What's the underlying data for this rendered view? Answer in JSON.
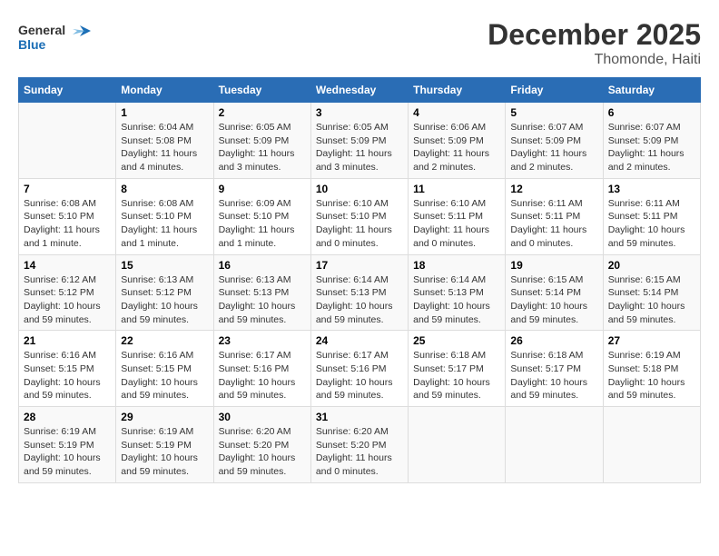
{
  "header": {
    "logo_line1": "General",
    "logo_line2": "Blue",
    "title": "December 2025",
    "subtitle": "Thomonde, Haiti"
  },
  "weekdays": [
    "Sunday",
    "Monday",
    "Tuesday",
    "Wednesday",
    "Thursday",
    "Friday",
    "Saturday"
  ],
  "weeks": [
    [
      {
        "day": "",
        "info": ""
      },
      {
        "day": "1",
        "info": "Sunrise: 6:04 AM\nSunset: 5:08 PM\nDaylight: 11 hours\nand 4 minutes."
      },
      {
        "day": "2",
        "info": "Sunrise: 6:05 AM\nSunset: 5:09 PM\nDaylight: 11 hours\nand 3 minutes."
      },
      {
        "day": "3",
        "info": "Sunrise: 6:05 AM\nSunset: 5:09 PM\nDaylight: 11 hours\nand 3 minutes."
      },
      {
        "day": "4",
        "info": "Sunrise: 6:06 AM\nSunset: 5:09 PM\nDaylight: 11 hours\nand 2 minutes."
      },
      {
        "day": "5",
        "info": "Sunrise: 6:07 AM\nSunset: 5:09 PM\nDaylight: 11 hours\nand 2 minutes."
      },
      {
        "day": "6",
        "info": "Sunrise: 6:07 AM\nSunset: 5:09 PM\nDaylight: 11 hours\nand 2 minutes."
      }
    ],
    [
      {
        "day": "7",
        "info": "Sunrise: 6:08 AM\nSunset: 5:10 PM\nDaylight: 11 hours\nand 1 minute."
      },
      {
        "day": "8",
        "info": "Sunrise: 6:08 AM\nSunset: 5:10 PM\nDaylight: 11 hours\nand 1 minute."
      },
      {
        "day": "9",
        "info": "Sunrise: 6:09 AM\nSunset: 5:10 PM\nDaylight: 11 hours\nand 1 minute."
      },
      {
        "day": "10",
        "info": "Sunrise: 6:10 AM\nSunset: 5:10 PM\nDaylight: 11 hours\nand 0 minutes."
      },
      {
        "day": "11",
        "info": "Sunrise: 6:10 AM\nSunset: 5:11 PM\nDaylight: 11 hours\nand 0 minutes."
      },
      {
        "day": "12",
        "info": "Sunrise: 6:11 AM\nSunset: 5:11 PM\nDaylight: 11 hours\nand 0 minutes."
      },
      {
        "day": "13",
        "info": "Sunrise: 6:11 AM\nSunset: 5:11 PM\nDaylight: 10 hours\nand 59 minutes."
      }
    ],
    [
      {
        "day": "14",
        "info": "Sunrise: 6:12 AM\nSunset: 5:12 PM\nDaylight: 10 hours\nand 59 minutes."
      },
      {
        "day": "15",
        "info": "Sunrise: 6:13 AM\nSunset: 5:12 PM\nDaylight: 10 hours\nand 59 minutes."
      },
      {
        "day": "16",
        "info": "Sunrise: 6:13 AM\nSunset: 5:13 PM\nDaylight: 10 hours\nand 59 minutes."
      },
      {
        "day": "17",
        "info": "Sunrise: 6:14 AM\nSunset: 5:13 PM\nDaylight: 10 hours\nand 59 minutes."
      },
      {
        "day": "18",
        "info": "Sunrise: 6:14 AM\nSunset: 5:13 PM\nDaylight: 10 hours\nand 59 minutes."
      },
      {
        "day": "19",
        "info": "Sunrise: 6:15 AM\nSunset: 5:14 PM\nDaylight: 10 hours\nand 59 minutes."
      },
      {
        "day": "20",
        "info": "Sunrise: 6:15 AM\nSunset: 5:14 PM\nDaylight: 10 hours\nand 59 minutes."
      }
    ],
    [
      {
        "day": "21",
        "info": "Sunrise: 6:16 AM\nSunset: 5:15 PM\nDaylight: 10 hours\nand 59 minutes."
      },
      {
        "day": "22",
        "info": "Sunrise: 6:16 AM\nSunset: 5:15 PM\nDaylight: 10 hours\nand 59 minutes."
      },
      {
        "day": "23",
        "info": "Sunrise: 6:17 AM\nSunset: 5:16 PM\nDaylight: 10 hours\nand 59 minutes."
      },
      {
        "day": "24",
        "info": "Sunrise: 6:17 AM\nSunset: 5:16 PM\nDaylight: 10 hours\nand 59 minutes."
      },
      {
        "day": "25",
        "info": "Sunrise: 6:18 AM\nSunset: 5:17 PM\nDaylight: 10 hours\nand 59 minutes."
      },
      {
        "day": "26",
        "info": "Sunrise: 6:18 AM\nSunset: 5:17 PM\nDaylight: 10 hours\nand 59 minutes."
      },
      {
        "day": "27",
        "info": "Sunrise: 6:19 AM\nSunset: 5:18 PM\nDaylight: 10 hours\nand 59 minutes."
      }
    ],
    [
      {
        "day": "28",
        "info": "Sunrise: 6:19 AM\nSunset: 5:19 PM\nDaylight: 10 hours\nand 59 minutes."
      },
      {
        "day": "29",
        "info": "Sunrise: 6:19 AM\nSunset: 5:19 PM\nDaylight: 10 hours\nand 59 minutes."
      },
      {
        "day": "30",
        "info": "Sunrise: 6:20 AM\nSunset: 5:20 PM\nDaylight: 10 hours\nand 59 minutes."
      },
      {
        "day": "31",
        "info": "Sunrise: 6:20 AM\nSunset: 5:20 PM\nDaylight: 11 hours\nand 0 minutes."
      },
      {
        "day": "",
        "info": ""
      },
      {
        "day": "",
        "info": ""
      },
      {
        "day": "",
        "info": ""
      }
    ]
  ]
}
